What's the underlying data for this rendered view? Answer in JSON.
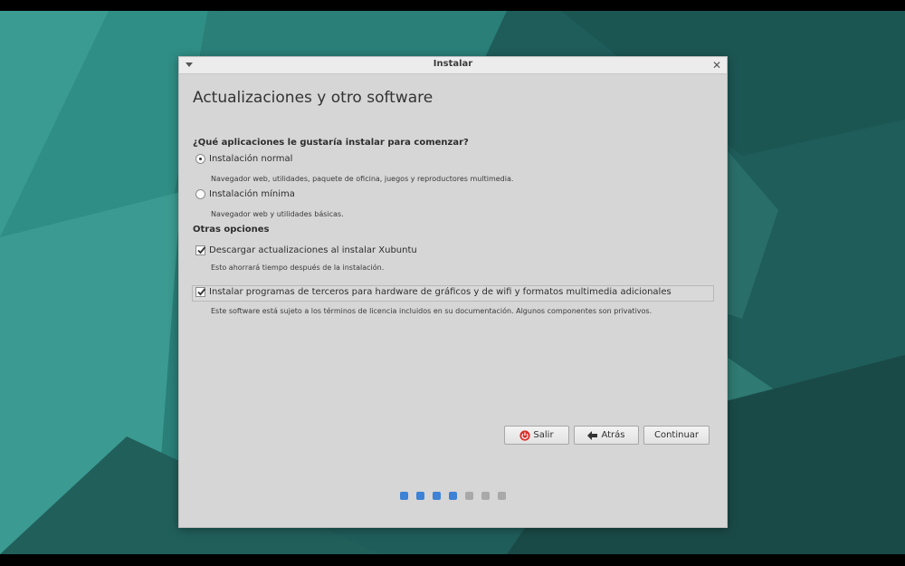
{
  "window": {
    "title": "Instalar"
  },
  "page": {
    "heading": "Actualizaciones y otro software",
    "question": "¿Qué aplicaciones le gustaría instalar para comenzar?",
    "install_options": [
      {
        "label": "Instalación normal",
        "description": "Navegador web, utilidades, paquete de oficina, juegos y reproductores multimedia.",
        "selected": true
      },
      {
        "label": "Instalación mínima",
        "description": "Navegador web y utilidades básicas.",
        "selected": false
      }
    ],
    "other_section_label": "Otras opciones",
    "other_options": [
      {
        "label": "Descargar actualizaciones al instalar Xubuntu",
        "description": "Esto ahorrará tiempo después de la instalación.",
        "checked": true
      },
      {
        "label": "Instalar programas de terceros para hardware de gráficos y de wifi y formatos multimedia adicionales",
        "description": "Este software está sujeto a los términos de licencia incluidos en su documentación. Algunos componentes son privativos.",
        "checked": true
      }
    ]
  },
  "buttons": {
    "quit": "Salir",
    "back": "Atrás",
    "continue": "Continuar"
  },
  "progress": {
    "total_steps": 7,
    "completed_steps": 4
  },
  "colors": {
    "accent": "#3d82d6",
    "quit_icon": "#d9302c",
    "desktop_bg": "#1f5d5a"
  },
  "icons": {
    "window_menu": "chevron-down-icon",
    "close": "close-icon",
    "quit": "power-icon",
    "back": "arrow-left-icon"
  }
}
